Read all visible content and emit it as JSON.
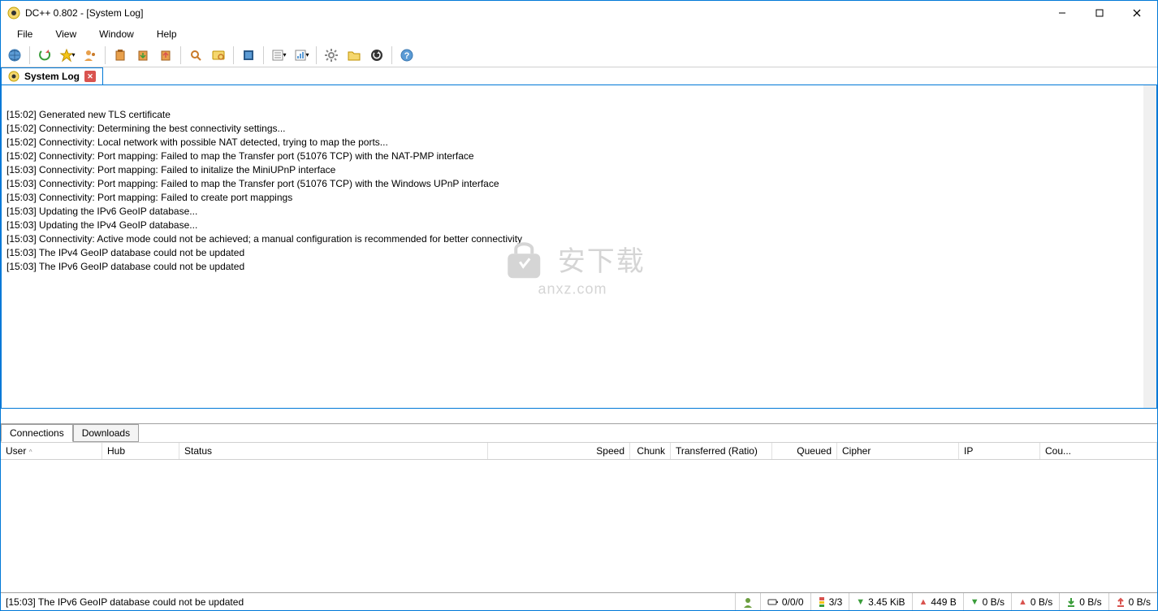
{
  "window": {
    "title": "DC++ 0.802 - [System Log]"
  },
  "menu": {
    "file": "File",
    "view": "View",
    "window": "Window",
    "help": "Help"
  },
  "tab": {
    "label": "System Log"
  },
  "log": {
    "lines": [
      "[15:02] Generated new TLS certificate",
      "[15:02] Connectivity: Determining the best connectivity settings...",
      "[15:02] Connectivity: Local network with possible NAT detected, trying to map the ports...",
      "[15:02] Connectivity: Port mapping: Failed to map the Transfer port (51076 TCP) with the NAT-PMP interface",
      "[15:03] Connectivity: Port mapping: Failed to initalize the MiniUPnP interface",
      "[15:03] Connectivity: Port mapping: Failed to map the Transfer port (51076 TCP) with the Windows UPnP interface",
      "[15:03] Connectivity: Port mapping: Failed to create port mappings",
      "[15:03] Updating the IPv6 GeoIP database...",
      "[15:03] Updating the IPv4 GeoIP database...",
      "[15:03] Connectivity: Active mode could not be achieved; a manual configuration is recommended for better connectivity",
      "[15:03] The IPv4 GeoIP database could not be updated",
      "[15:03] The IPv6 GeoIP database could not be updated"
    ]
  },
  "watermark": {
    "main": "安下载",
    "sub": "anxz.com"
  },
  "bottomTabs": {
    "connections": "Connections",
    "downloads": "Downloads"
  },
  "columns": {
    "user": "User",
    "hub": "Hub",
    "status": "Status",
    "speed": "Speed",
    "chunk": "Chunk",
    "transferred": "Transferred (Ratio)",
    "queued": "Queued",
    "cipher": "Cipher",
    "ip": "IP",
    "country": "Cou..."
  },
  "status": {
    "text": "[15:03] The IPv6 GeoIP database could not be updated",
    "slots": "0/0/0",
    "hubs": "3/3",
    "down_total": "3.45 KiB",
    "up_total": "449 B",
    "down_rate1": "0 B/s",
    "up_rate1": "0 B/s",
    "down_rate2": "0 B/s",
    "up_rate2": "0 B/s"
  }
}
